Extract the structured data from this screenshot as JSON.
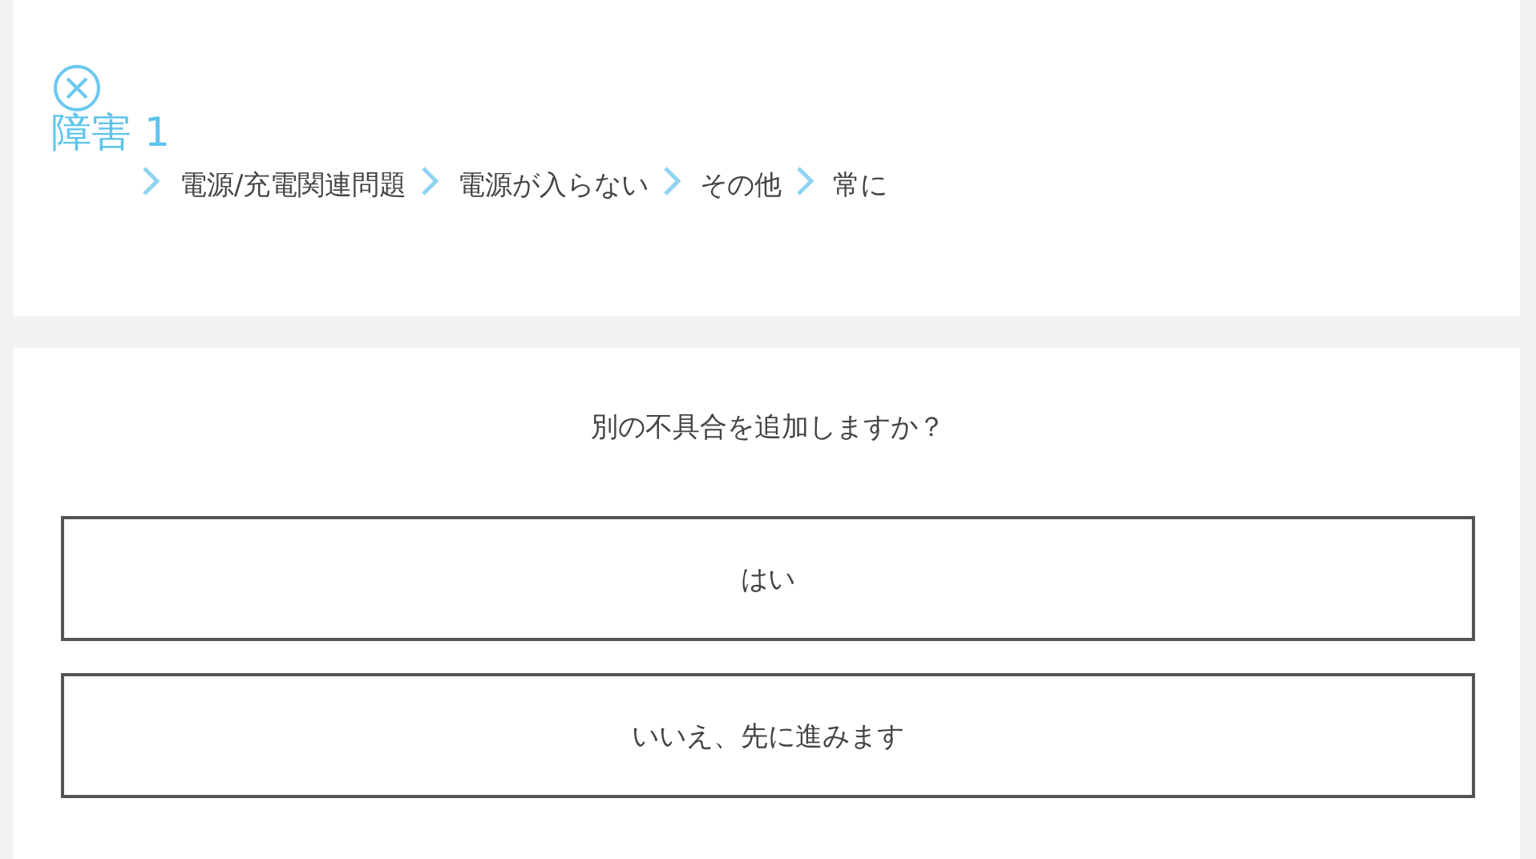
{
  "fault": {
    "title": "障害 1",
    "breadcrumb": [
      "電源/充電関連問題",
      "電源が入らない",
      "その他",
      "常に"
    ]
  },
  "question": {
    "text": "別の不具合を追加しますか？",
    "options": [
      "はい",
      "いいえ、先に進みます"
    ]
  }
}
